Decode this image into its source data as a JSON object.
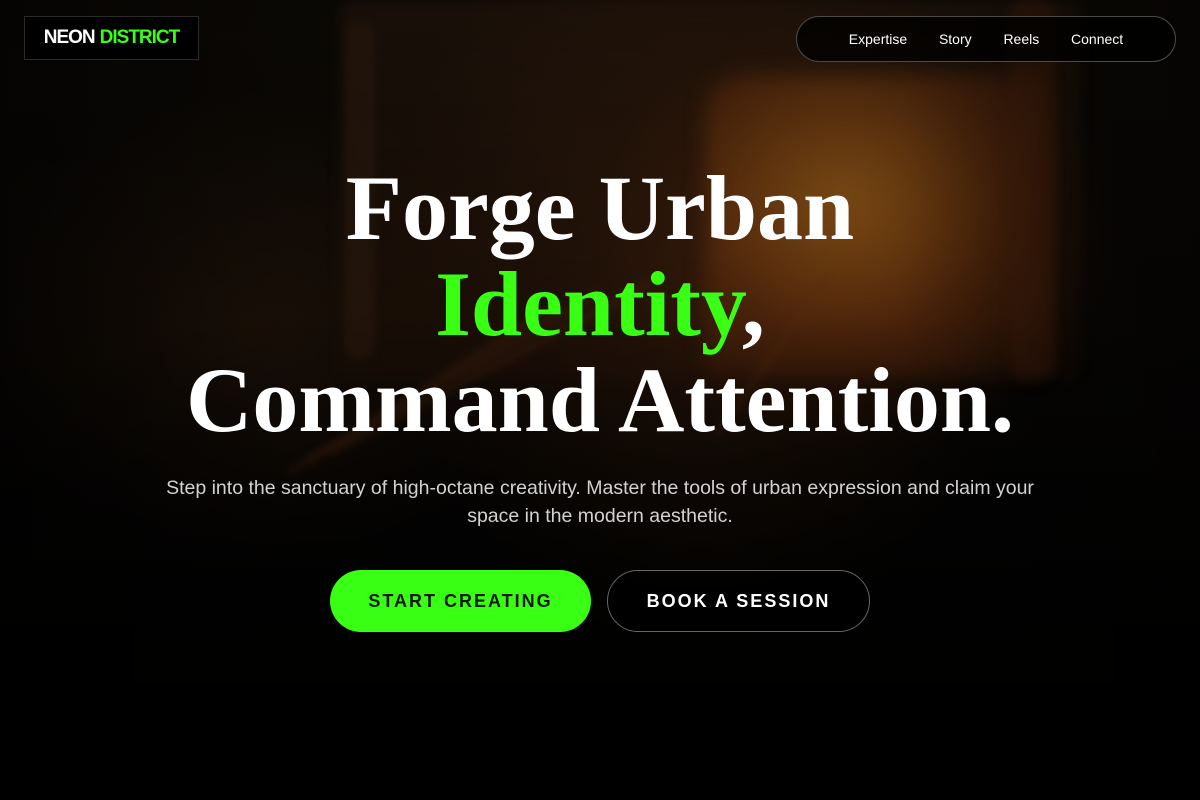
{
  "brand": {
    "part1": "NEON",
    "part2": "DISTRICT"
  },
  "nav": {
    "items": [
      "Expertise",
      "Story",
      "Reels",
      "Connect"
    ]
  },
  "hero": {
    "line1": "Forge Urban",
    "line2_accent": "Identity",
    "line2_suffix": ",",
    "line3": "Command Attention.",
    "subtitle": "Step into the sanctuary of high-octane creativity. Master the tools of urban expression and claim your space in the modern aesthetic.",
    "primary_cta": "START CREATING",
    "secondary_cta": "BOOK A SESSION"
  },
  "colors": {
    "accent": "#39ff14",
    "background": "#000000",
    "text": "#ffffff",
    "subtext": "#d2d2d2"
  }
}
